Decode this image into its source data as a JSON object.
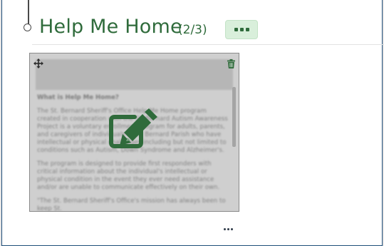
{
  "section": {
    "title": "Help Me Home",
    "count": "(2/3)",
    "more_icon": "more-horizontal-icon"
  },
  "card": {
    "move_icon": "move-arrows-icon",
    "delete_icon": "trash-icon",
    "edit_icon": "pencil-square-icon",
    "preview": {
      "heading": "What is Help Me Home?",
      "paragraph_1": "The St. Bernard Sheriff's Office Help Me Home program created in cooperation with the St. Bernard Autism Awareness Project is a voluntary enrollment program for adults, parents, and caregivers of individuals in St. Bernard Parish who have intellectual or physical challenges including but not limited to conditions such as Autism, Down Syndrome and Alzheimer's.",
      "paragraph_2": "The program is designed to provide first responders with critical information about the individual's intellectual or physical condition in the event they ever need assistance and/or are unable to communicate effectively on their own.",
      "paragraph_3": "\"The St. Bernard Sheriff's Office's mission has always been to keep St."
    }
  },
  "footer": {
    "more_icon": "more-horizontal-icon"
  },
  "colors": {
    "accent": "#2f6b3b",
    "accent_light": "#d9efdb",
    "frame_border": "#1f4e79"
  }
}
